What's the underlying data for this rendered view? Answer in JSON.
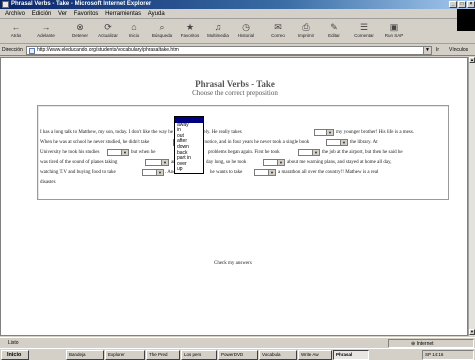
{
  "window": {
    "title": "Phrasal Verbs - Take - Microsoft Internet Explorer"
  },
  "menu": [
    "Archivo",
    "Edición",
    "Ver",
    "Favoritos",
    "Herramientas",
    "Ayuda"
  ],
  "toolbar": [
    {
      "label": "Atrás",
      "icon": "back-icon"
    },
    {
      "label": "Adelante",
      "icon": "forward-icon"
    },
    {
      "label": "Detener",
      "icon": "stop-icon"
    },
    {
      "label": "Actualizar",
      "icon": "refresh-icon"
    },
    {
      "label": "Inicio",
      "icon": "home-icon"
    },
    {
      "label": "Búsqueda",
      "icon": "search-icon"
    },
    {
      "label": "Favoritos",
      "icon": "favorites-icon"
    },
    {
      "label": "Multimedia",
      "icon": "media-icon"
    },
    {
      "label": "Historial",
      "icon": "history-icon"
    },
    {
      "label": "Correo",
      "icon": "mail-icon"
    },
    {
      "label": "Imprimir",
      "icon": "print-icon"
    },
    {
      "label": "Editar",
      "icon": "edit-icon"
    },
    {
      "label": "Comentar",
      "icon": "discuss-icon"
    },
    {
      "label": "Run SAP",
      "icon": "sap-icon"
    }
  ],
  "address": {
    "label": "Dirección",
    "url": "http://www.eleducando.org/students/vocabulary/phrasaltake.htm",
    "go": "Ir",
    "links": "Vínculos"
  },
  "page": {
    "title": "Phrasal Verbs - Take",
    "subtitle": "Choose the correct preposition",
    "text": [
      "I has a long talk to Matthew, my son, today. I don't like the way he is behaving lately. He really takes",
      "my younger brother! His life is a mess.",
      "When he was at school he never studied, he didn't take",
      "any notice, and in four years he never took a single book",
      "the library. At",
      "University he took his studies",
      "but when he",
      "problems began again. First he took",
      "the job at the airport, but then he said he",
      "was tired of the sound of planes taking",
      "and",
      "day long, so he took",
      "about me warning plans, and stayed at home all day,",
      "watching T.V and buying food to take",
      ". And",
      "he wants to take",
      "a marathon all over the country!! Mathew is a real",
      "disaster."
    ],
    "dropdown_options": [
      "away",
      "in",
      "out",
      "after",
      "down",
      "back",
      "part in",
      "over",
      "up"
    ],
    "check_button": "Check my answers"
  },
  "status": {
    "text": "Listo",
    "zone": "Internet"
  },
  "taskbar": {
    "start": "Inicio",
    "tasks": [
      "Bandeja",
      "Explorer",
      "The Pred",
      "Los pers",
      "PowerDVD",
      "Vocabula",
      "Write Aw",
      "Phrasal"
    ],
    "clock": "SP 14:16"
  }
}
